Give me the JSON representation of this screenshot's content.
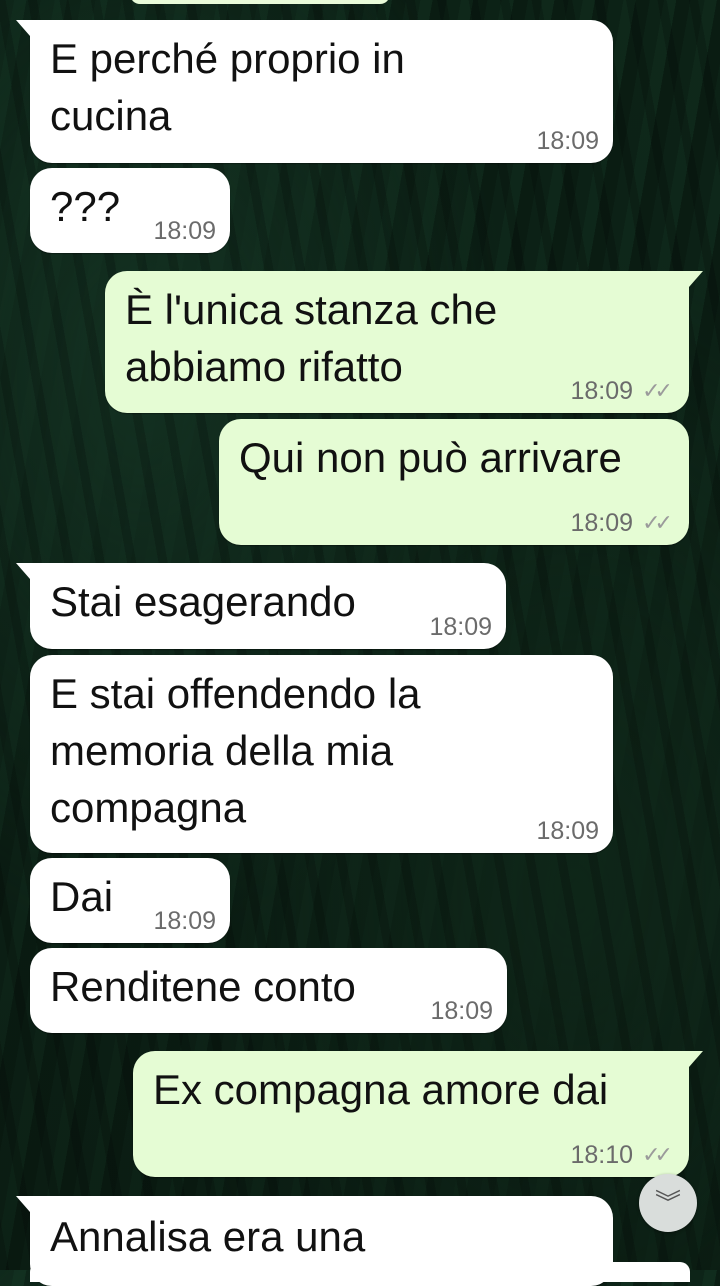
{
  "conversation": {
    "messages": [
      {
        "id": "m1",
        "direction": "incoming",
        "text": "E perché proprio in\ncucina",
        "time": "18:09"
      },
      {
        "id": "m2",
        "direction": "incoming",
        "text": "???",
        "time": "18:09"
      },
      {
        "id": "m3",
        "direction": "outgoing",
        "text": "È l'unica stanza che\nabbiamo rifatto",
        "time": "18:09",
        "status": "read"
      },
      {
        "id": "m4",
        "direction": "outgoing",
        "text": "Qui non può arrivare",
        "time": "18:09",
        "status": "read"
      },
      {
        "id": "m5",
        "direction": "incoming",
        "text": "Stai esagerando",
        "time": "18:09"
      },
      {
        "id": "m6",
        "direction": "incoming",
        "text": "E stai offendendo la\nmemoria della mia\ncompagna",
        "time": "18:09"
      },
      {
        "id": "m7",
        "direction": "incoming",
        "text": "Dai",
        "time": "18:09"
      },
      {
        "id": "m8",
        "direction": "incoming",
        "text": "Renditene conto",
        "time": "18:09"
      },
      {
        "id": "m9",
        "direction": "outgoing",
        "text": "Ex compagna amore dai",
        "time": "18:10",
        "status": "read"
      },
      {
        "id": "m10",
        "direction": "incoming",
        "text": "Annalisa era una",
        "time": ""
      }
    ],
    "status_icon": "double-check-icon",
    "scroll_button_icon": "double-chevron-down-icon"
  },
  "colors": {
    "incoming_bubble": "#ffffff",
    "outgoing_bubble": "#e5fcd4",
    "timestamp": "#6b6b6b",
    "wallpaper": "#0c2016"
  }
}
